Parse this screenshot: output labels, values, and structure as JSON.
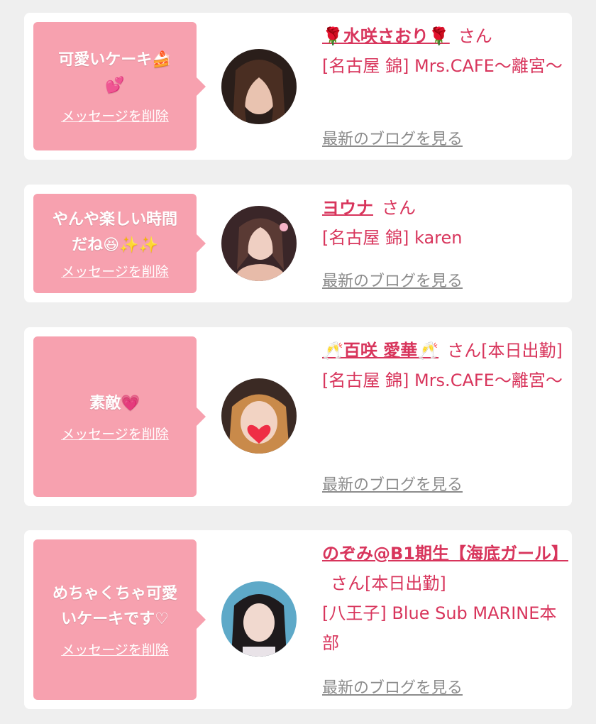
{
  "cards": [
    {
      "message_line1": "可愛いケーキ🍰",
      "message_line2": "💕",
      "delete_label": "メッセージを削除",
      "name": "🌹水咲さおり🌹",
      "honorific": "さん",
      "extra": "",
      "shop": "[名古屋 錦] Mrs.CAFE〜離宮〜",
      "blog_label": "最新のブログを見る"
    },
    {
      "message_line1": "やんや楽しい時間",
      "message_line2": "だね😆✨✨",
      "delete_label": "メッセージを削除",
      "name": "ヨウナ",
      "honorific": "さん",
      "extra": "",
      "shop": "[名古屋 錦] karen",
      "blog_label": "最新のブログを見る"
    },
    {
      "message_line1": "素敵💗",
      "message_line2": "",
      "delete_label": "メッセージを削除",
      "name": "🥂百咲 愛華🥂",
      "honorific": "さん",
      "extra": "[本日出勤]",
      "shop": "[名古屋 錦] Mrs.CAFE〜離宮〜",
      "blog_label": "最新のブログを見る"
    },
    {
      "message_line1": "めちゃくちゃ可愛",
      "message_line2": "いケーキです♡",
      "delete_label": "メッセージを削除",
      "name": "のぞみ@B1期生【海底ガール】",
      "honorific": "さん",
      "extra": "[本日出勤]",
      "shop": "[八王子] Blue Sub MARINE本部",
      "blog_label": "最新のブログを見る"
    }
  ],
  "colors": {
    "page_bg": "#efefef",
    "bubble_bg": "#f7a1af",
    "accent": "#d8355c",
    "link_gray": "#8c8c8c"
  }
}
